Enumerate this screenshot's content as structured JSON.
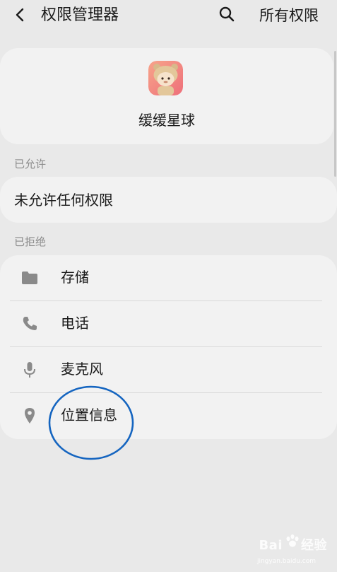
{
  "header": {
    "title": "权限管理器",
    "all_permissions_label": "所有权限",
    "back_icon": "chevron-left-icon",
    "search_icon": "search-icon"
  },
  "app": {
    "name": "缓缓星球",
    "icon": "app-icon"
  },
  "sections": {
    "allowed_label": "已允许",
    "allowed_empty_text": "未允许任何权限",
    "denied_label": "已拒绝"
  },
  "denied_permissions": [
    {
      "label": "存储",
      "icon": "folder-icon"
    },
    {
      "label": "电话",
      "icon": "phone-icon"
    },
    {
      "label": "麦克风",
      "icon": "microphone-icon"
    },
    {
      "label": "位置信息",
      "icon": "location-pin-icon"
    }
  ],
  "watermark": {
    "brand": "Bai",
    "brand_suffix": "经验",
    "url": "jingyan.baidu.com"
  },
  "colors": {
    "background": "#e9e9e9",
    "card": "#f2f2f2",
    "annotation": "#1565c0",
    "icon_gray": "#8a8a8a"
  }
}
